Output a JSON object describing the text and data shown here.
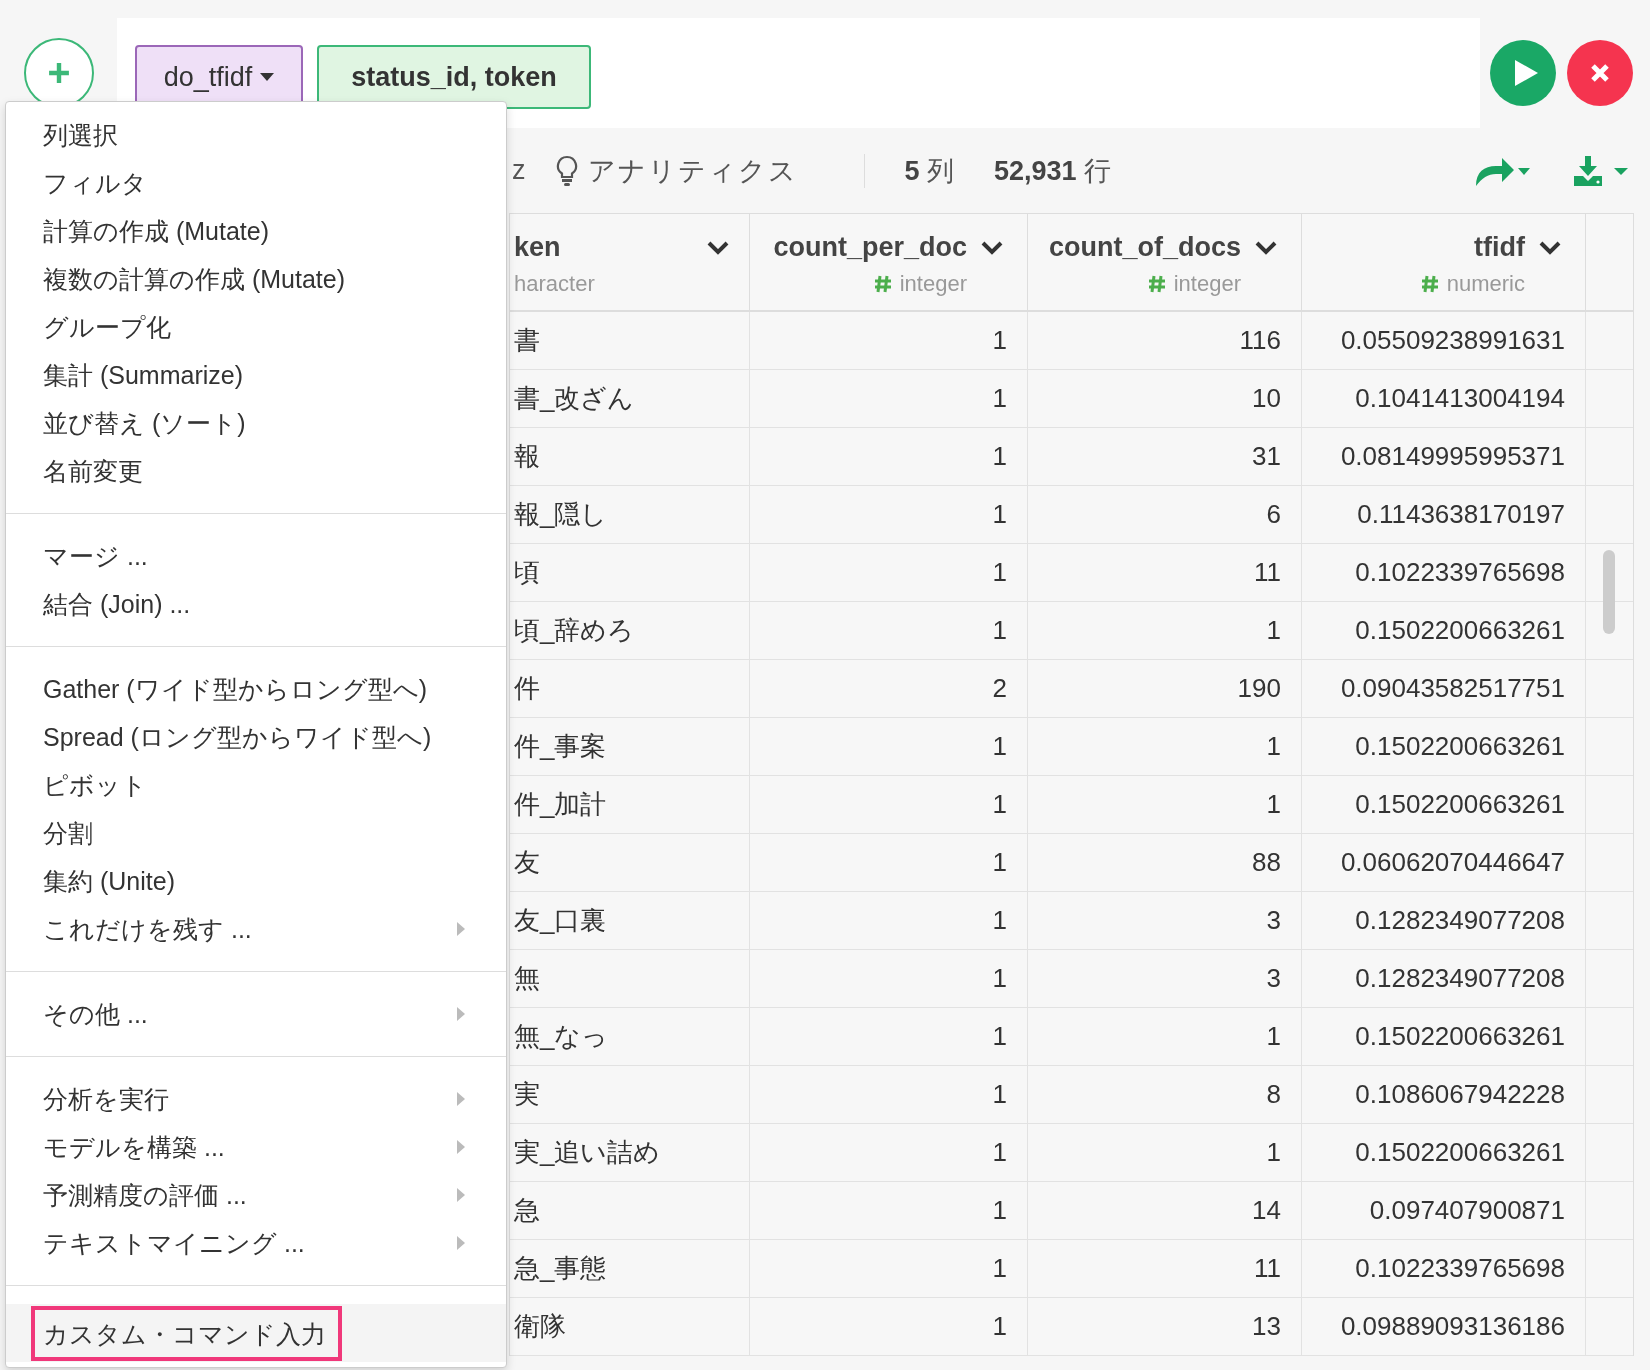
{
  "step_bar": {
    "command": "do_tfidf",
    "arguments": "status_id, token"
  },
  "toolbar": {
    "cut_label": "z",
    "analytics": "アナリティクス",
    "column_count": "5",
    "column_unit": "列",
    "row_count": "52,931",
    "row_unit": "行"
  },
  "table": {
    "columns": [
      {
        "name": "ken",
        "type": "haracter",
        "type_icon": false
      },
      {
        "name": "count_per_doc",
        "type": "integer",
        "type_icon": true
      },
      {
        "name": "count_of_docs",
        "type": "integer",
        "type_icon": true
      },
      {
        "name": "tfidf",
        "type": "numeric",
        "type_icon": true
      }
    ],
    "rows": [
      [
        "書",
        "1",
        "116",
        "0.05509238991631"
      ],
      [
        "書_改ざん",
        "1",
        "10",
        "0.1041413004194"
      ],
      [
        "報",
        "1",
        "31",
        "0.08149995995371"
      ],
      [
        "報_隠し",
        "1",
        "6",
        "0.1143638170197"
      ],
      [
        "頃",
        "1",
        "11",
        "0.1022339765698"
      ],
      [
        "頃_辞めろ",
        "1",
        "1",
        "0.1502200663261"
      ],
      [
        "件",
        "2",
        "190",
        "0.09043582517751"
      ],
      [
        "件_事案",
        "1",
        "1",
        "0.1502200663261"
      ],
      [
        "件_加計",
        "1",
        "1",
        "0.1502200663261"
      ],
      [
        "友",
        "1",
        "88",
        "0.06062070446647"
      ],
      [
        "友_口裏",
        "1",
        "3",
        "0.1282349077208"
      ],
      [
        "無",
        "1",
        "3",
        "0.1282349077208"
      ],
      [
        "無_なっ",
        "1",
        "1",
        "0.1502200663261"
      ],
      [
        "実",
        "1",
        "8",
        "0.1086067942228"
      ],
      [
        "実_追い詰め",
        "1",
        "1",
        "0.1502200663261"
      ],
      [
        "急",
        "1",
        "14",
        "0.097407900871"
      ],
      [
        "急_事態",
        "1",
        "11",
        "0.1022339765698"
      ],
      [
        "衛隊",
        "1",
        "13",
        "0.09889093136186"
      ]
    ]
  },
  "menu": {
    "groups": [
      {
        "items": [
          {
            "label": "列選択",
            "submenu": false,
            "selected": false
          },
          {
            "label": "フィルタ",
            "submenu": false,
            "selected": false
          },
          {
            "label": "計算の作成 (Mutate)",
            "submenu": false,
            "selected": false
          },
          {
            "label": "複数の計算の作成 (Mutate)",
            "submenu": false,
            "selected": false
          },
          {
            "label": "グループ化",
            "submenu": false,
            "selected": false
          },
          {
            "label": "集計 (Summarize)",
            "submenu": false,
            "selected": false
          },
          {
            "label": "並び替え (ソート)",
            "submenu": false,
            "selected": false
          },
          {
            "label": "名前変更",
            "submenu": false,
            "selected": false
          }
        ]
      },
      {
        "items": [
          {
            "label": "マージ ...",
            "submenu": false,
            "selected": false
          },
          {
            "label": "結合 (Join) ...",
            "submenu": false,
            "selected": false
          }
        ]
      },
      {
        "items": [
          {
            "label": "Gather (ワイド型からロング型へ)",
            "submenu": false,
            "selected": false
          },
          {
            "label": "Spread (ロング型からワイド型へ)",
            "submenu": false,
            "selected": false
          },
          {
            "label": "ピボット",
            "submenu": false,
            "selected": false
          },
          {
            "label": "分割",
            "submenu": false,
            "selected": false
          },
          {
            "label": "集約 (Unite)",
            "submenu": false,
            "selected": false
          },
          {
            "label": "これだけを残す ...",
            "submenu": true,
            "selected": false
          }
        ]
      },
      {
        "items": [
          {
            "label": "その他 ...",
            "submenu": true,
            "selected": false
          }
        ]
      },
      {
        "items": [
          {
            "label": "分析を実行",
            "submenu": true,
            "selected": false
          },
          {
            "label": "モデルを構築 ...",
            "submenu": true,
            "selected": false
          },
          {
            "label": "予測精度の評価 ...",
            "submenu": true,
            "selected": false
          },
          {
            "label": "テキストマイニング ...",
            "submenu": true,
            "selected": false
          }
        ]
      },
      {
        "items": [
          {
            "label": "カスタム・コマンド入力",
            "submenu": false,
            "selected": true
          }
        ]
      }
    ]
  }
}
